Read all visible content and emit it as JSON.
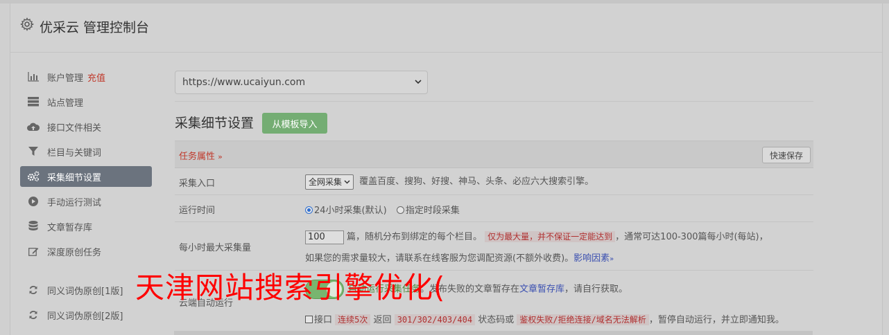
{
  "header": {
    "title": "优采云 管理控制台",
    "icon": "gear-icon"
  },
  "sidebar": {
    "items": [
      {
        "label": "账户管理",
        "extra": "充值",
        "icon": "bar-chart-icon"
      },
      {
        "label": "站点管理",
        "icon": "server-icon"
      },
      {
        "label": "接口文件相关",
        "icon": "cloud-upload-icon"
      },
      {
        "label": "栏目与关键词",
        "icon": "filter-icon"
      },
      {
        "label": "采集细节设置",
        "icon": "gears-icon",
        "active": true
      },
      {
        "label": "手动运行测试",
        "icon": "play-circle-icon"
      },
      {
        "label": "文章暂存库",
        "icon": "database-icon"
      },
      {
        "label": "深度原创任务",
        "icon": "edit-icon"
      },
      {
        "label": "同义词伪原创[1版]",
        "icon": "refresh-icon"
      },
      {
        "label": "同义词伪原创[2版]",
        "icon": "refresh-icon"
      }
    ]
  },
  "main": {
    "site_select": "https://www.ucaiyun.com",
    "section_title": "采集细节设置",
    "import_button": "从模板导入",
    "task_attr": "任务属性",
    "quick_save": "快速保存",
    "rows": {
      "entry": {
        "label": "采集入口",
        "select_value": "全网采集",
        "desc": "覆盖百度、搜狗、好搜、神马、头条、必应六大搜索引擎。"
      },
      "runtime": {
        "label": "运行时间",
        "opt1": "24小时采集(默认)",
        "opt2": "指定时段采集"
      },
      "max": {
        "label": "每小时最大采集量",
        "value": "100",
        "text1": "篇，随机分布到绑定的每个栏目。",
        "highlight": "仅为最大量，并不保证一定能达到",
        "text2": "，通常可达100-300篇每小时(每站)，",
        "text3": "如果您的需求量较大，请联系在线客服为您调配资源(不额外收费)。",
        "link": "影响因素"
      },
      "cloud": {
        "label": "云端自动运行",
        "text_green": "自动运行采集任务",
        "text1": "。发布失败的文章暂存在",
        "link": "文章暂存库",
        "text2": "，请自行获取。",
        "chk_label": "接口",
        "hl1": "连续5次",
        "t_return": "返回",
        "hl2": "301/302/403/404",
        "t_status": "状态码或",
        "hl3": "鉴权失败/拒绝连接/域名无法解析",
        "t_end": "，暂停自动运行，并立即通知我。"
      }
    }
  },
  "overlay_text": "天津网站搜索引擎优化(",
  "colors": {
    "accent_red": "#c0392b",
    "button_green": "#74ad73",
    "active_sidebar": "#6b737e",
    "link_blue": "#3a4fb0"
  }
}
